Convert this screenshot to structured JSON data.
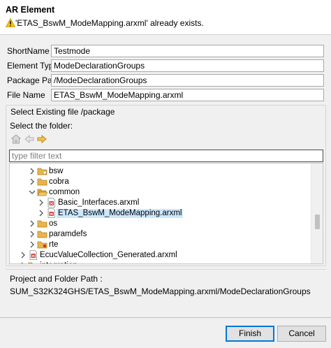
{
  "header": {
    "title": "AR Element",
    "message": "'ETAS_BswM_ModeMapping.arxml' already exists.",
    "icon": "warning-icon"
  },
  "form": {
    "short_name": {
      "label": "ShortName",
      "value": "Testmode"
    },
    "element_type": {
      "label": "Element Type",
      "value": "ModeDeclarationGroups"
    },
    "package_path": {
      "label": "Package Path",
      "value": "/ModeDeclarationGroups"
    },
    "file_name": {
      "label": "File Name",
      "value": "ETAS_BswM_ModeMapping.arxml"
    }
  },
  "select_group": {
    "title": "Select Existing file /package",
    "folder_label": "Select the folder:",
    "toolbar": [
      "home-icon",
      "back-arrow-icon",
      "forward-arrow-icon"
    ],
    "filter_placeholder": "type filter text",
    "tree": [
      {
        "label": "bsw",
        "icon": "folder-icon",
        "expanded": false
      },
      {
        "label": "cobra",
        "icon": "folder-icon",
        "expanded": false
      },
      {
        "label": "common",
        "icon": "folder-open-icon",
        "expanded": true
      },
      {
        "label": "Basic_Interfaces.arxml",
        "icon": "arxml-file-icon",
        "expanded": false
      },
      {
        "label": "ETAS_BswM_ModeMapping.arxml",
        "icon": "arxml-file-icon",
        "expanded": false,
        "selected": true
      },
      {
        "label": "os",
        "icon": "folder-icon",
        "expanded": false
      },
      {
        "label": "paramdefs",
        "icon": "folder-icon",
        "expanded": false
      },
      {
        "label": "rte",
        "icon": "folder-icon",
        "expanded": false
      },
      {
        "label": "EcucValueCollection_Generated.arxml",
        "icon": "arxml-file-icon",
        "expanded": false
      },
      {
        "label": "integration",
        "icon": "folder-icon",
        "expanded": false
      }
    ]
  },
  "project_path": {
    "label": "Project and Folder Path :",
    "value": "SUM_S32K324GHS/ETAS_BswM_ModeMapping.arxml/ModeDeclarationGroups"
  },
  "buttons": {
    "finish": "Finish",
    "cancel": "Cancel"
  },
  "colors": {
    "selection": "#cce8ff",
    "folder": "#e8b54a",
    "default_button_border": "#0078d7"
  }
}
